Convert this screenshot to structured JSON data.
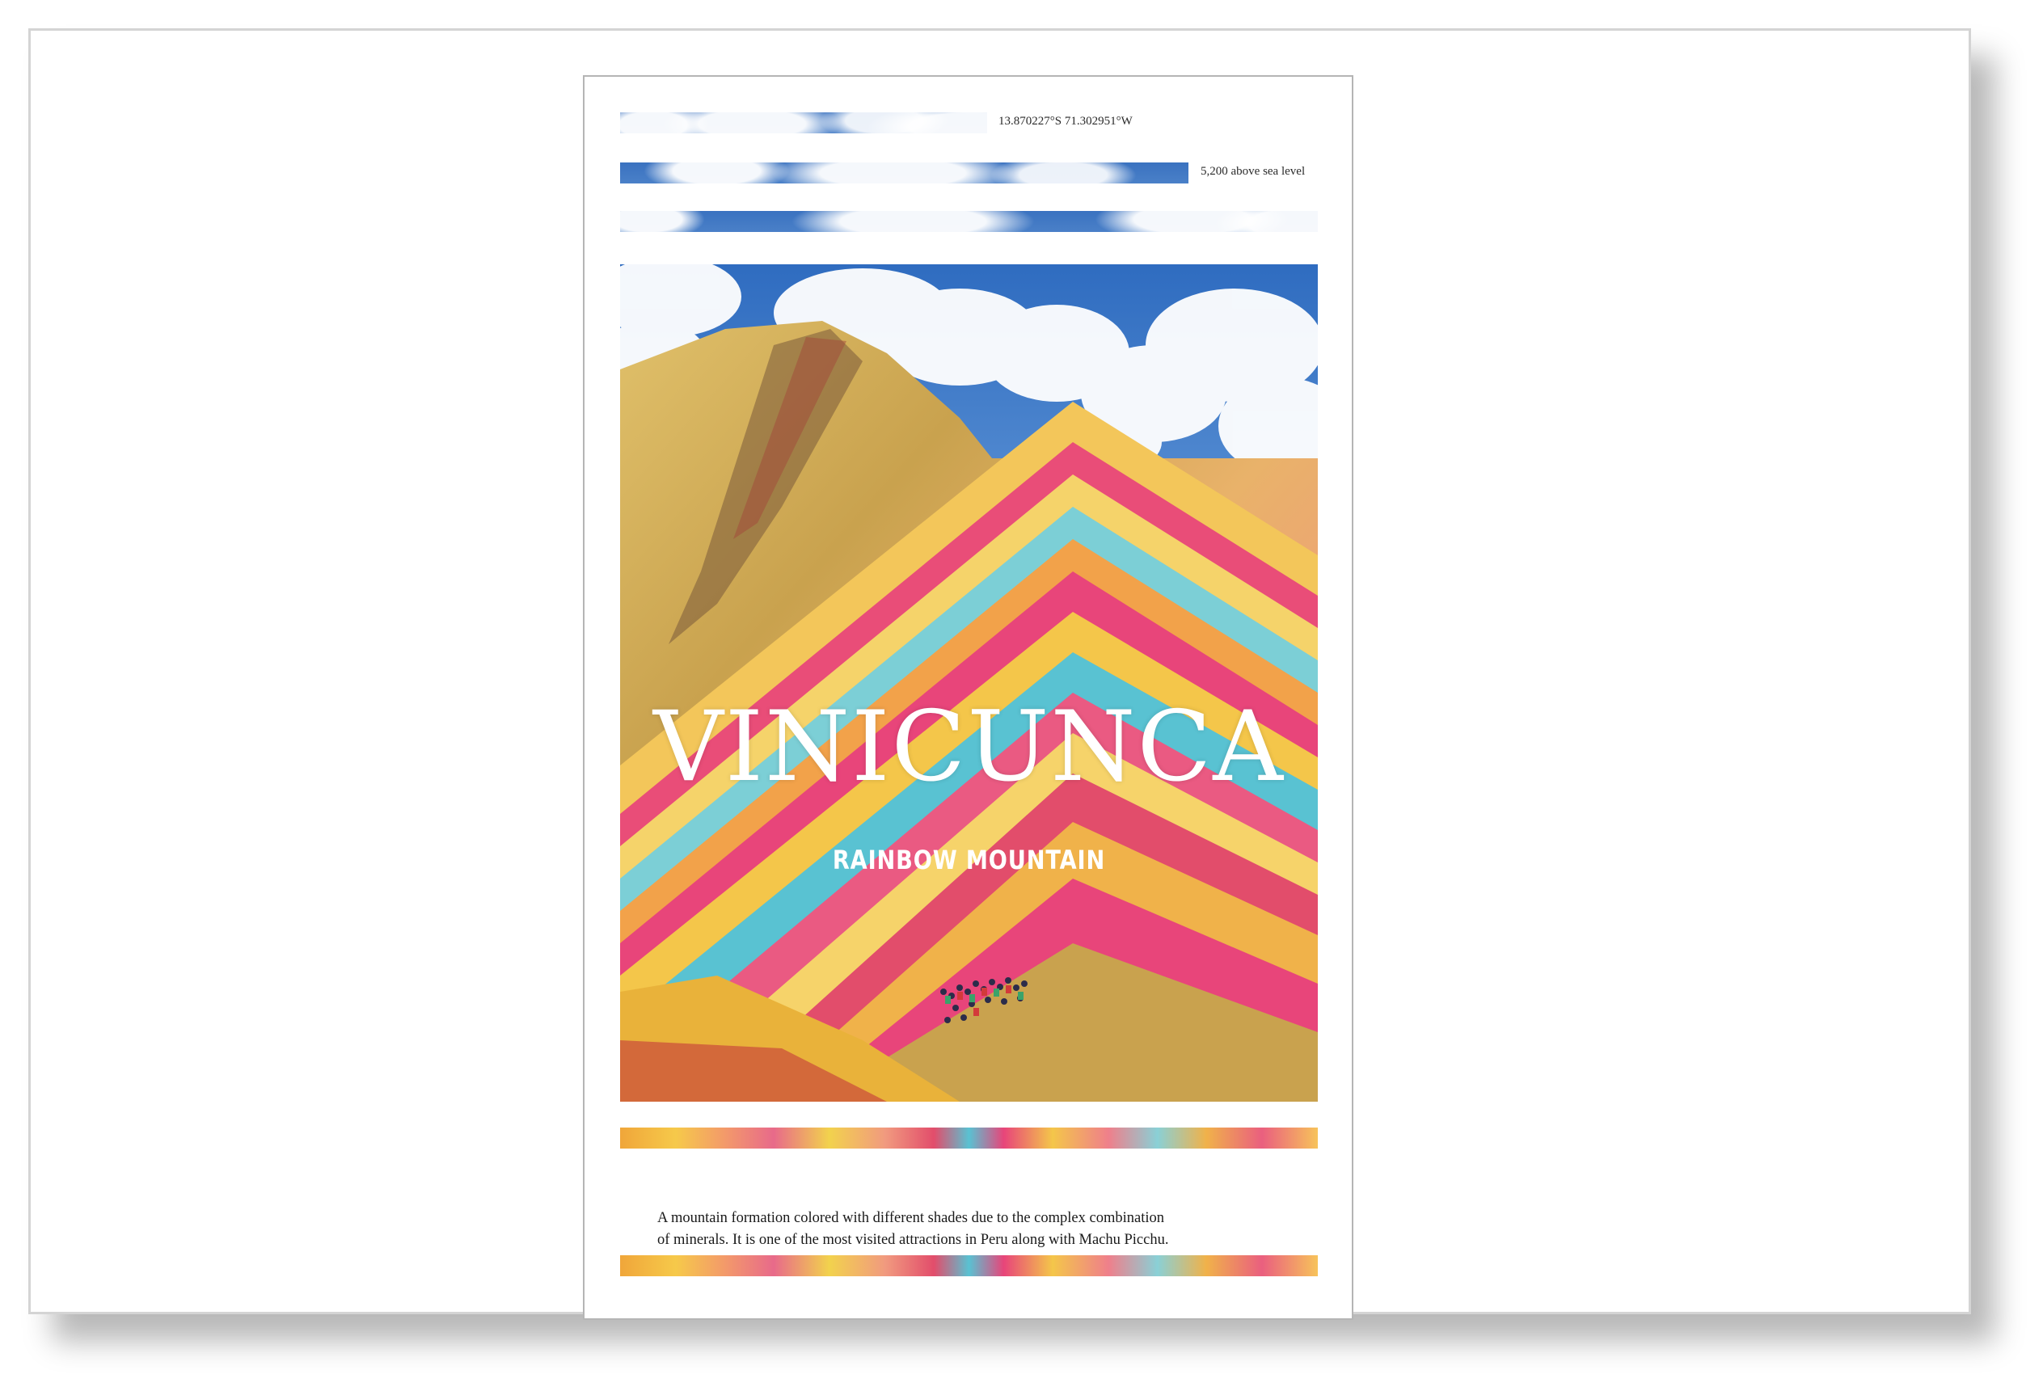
{
  "poster": {
    "coordinates": "13.870227°S 71.302951°W",
    "elevation": "5,200 above sea level",
    "title": "VINICUNCA",
    "subtitle": "RAINBOW MOUNTAIN",
    "caption_line1": "A mountain formation colored with different shades due to the complex combination",
    "caption_line2": "of minerals. It is one of the most visited attractions in Peru along with Machu Picchu."
  },
  "colors": {
    "sky_blue": "#3a72c0",
    "magenta": "#e24d6b",
    "turquoise": "#59c2d2",
    "yellow": "#f4c64a"
  }
}
